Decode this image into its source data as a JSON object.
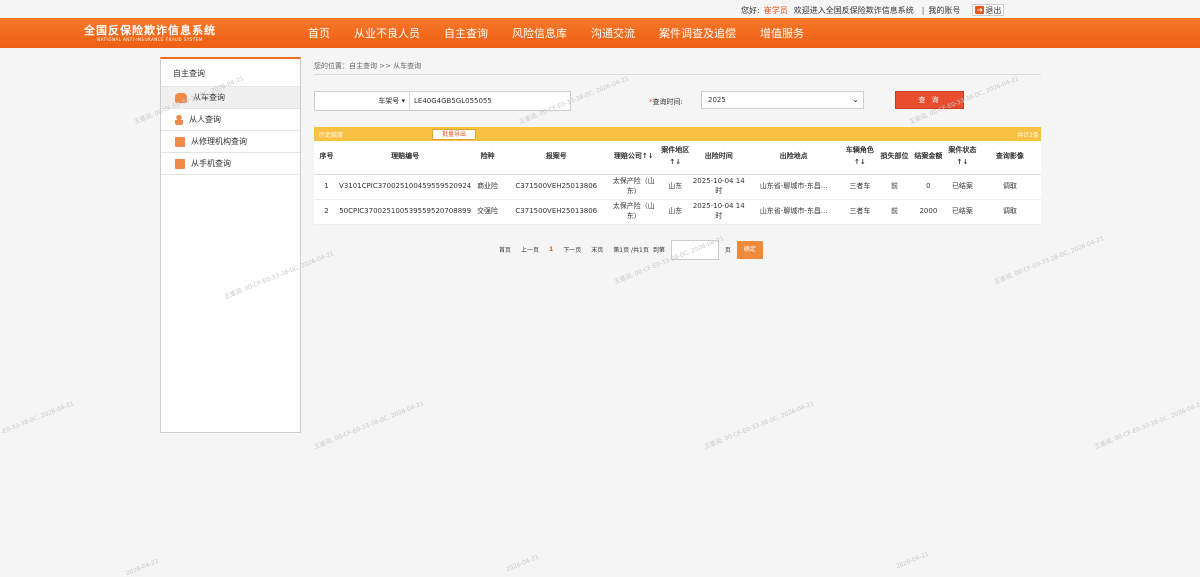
{
  "topbar": {
    "greeting": "您好:",
    "user": "崔学员",
    "welcome": "欢迎进入全国反保险欺诈信息系统",
    "sep": "|",
    "my_account": "我的账号",
    "logout": "退出"
  },
  "logo": {
    "cn": "全国反保险欺诈信息系统",
    "en": "NATIONAL ANTI-INSURANCE FRAUD SYSTEM"
  },
  "nav": [
    {
      "label": "首页"
    },
    {
      "label": "从业不良人员"
    },
    {
      "label": "自主查询"
    },
    {
      "label": "风险信息库"
    },
    {
      "label": "沟通交流"
    },
    {
      "label": "案件调查及追偿"
    },
    {
      "label": "增值服务"
    }
  ],
  "sidebar": {
    "title": "自主查询",
    "items": [
      {
        "label": "从车查询",
        "icon": "car-icon"
      },
      {
        "label": "从人查询",
        "icon": "person-icon"
      },
      {
        "label": "从修理机构查询",
        "icon": "calendar-icon"
      },
      {
        "label": "从手机查询",
        "icon": "calendar-icon"
      }
    ]
  },
  "breadcrumb": "您的位置：自主查询 >> 从车查询",
  "search": {
    "field_type": "车架号",
    "vin": "LE40G4GB5GL055055",
    "time_label": "查询时间:",
    "time_star": "*",
    "time_value": "2025",
    "query_button": "查 询"
  },
  "results": {
    "title": "历史赔案",
    "export_button": "批量导出",
    "total": "共计2条",
    "columns": [
      "序号",
      "理赔编号",
      "险种",
      "报案号",
      "理赔公司↑↓",
      "案件地区↑↓",
      "出险时间",
      "出险地点",
      "车辆角色↑↓",
      "损失部位",
      "结案金额",
      "案件状态↑↓",
      "查询影像"
    ],
    "rows": [
      [
        "1",
        "V3101CPIC370025100459559520924",
        "商业险",
        "C371500VEH25013806",
        "太保产险（山东）",
        "山东",
        "2025-10-04 14时",
        "山东省-聊城市-东昌...",
        "三者车",
        "前",
        "0",
        "已结案",
        "调取"
      ],
      [
        "2",
        "50CPIC370025100539559520708899",
        "交强险",
        "C371500VEH25013806",
        "太保产险（山东）",
        "山东",
        "2025-10-04 14时",
        "山东省-聊城市-东昌...",
        "三者车",
        "前",
        "2000",
        "已结案",
        "调取"
      ]
    ]
  },
  "pager": {
    "first": "首页",
    "prev": "上一页",
    "current": "1",
    "next": "下一页",
    "last": "末页",
    "info": "第1页 /共1页",
    "goto": "到第",
    "unit": "页",
    "confirm": "确定"
  },
  "watermark": "王鉴润, 00-CF-E0-33-38-0C, 2026-04-21",
  "watermark_date": "2026-04-21"
}
